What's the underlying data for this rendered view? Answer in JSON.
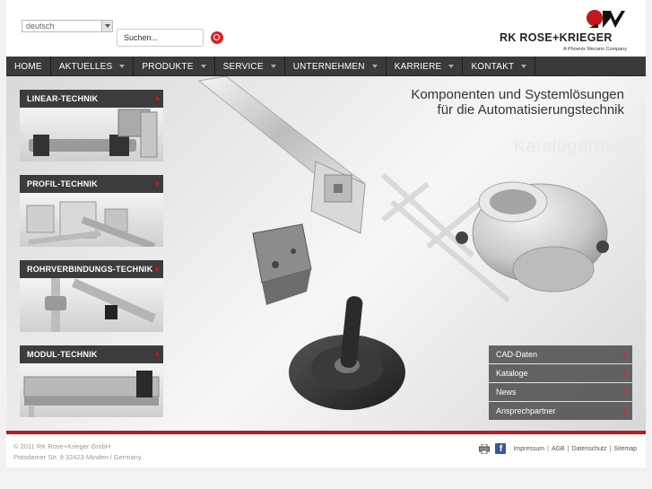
{
  "header": {
    "language": "deutsch",
    "search_placeholder": "Suchen...",
    "logo_text": "RK ROSE+KRIEGER",
    "logo_subtext": "A Phoenix Mecano Company"
  },
  "nav": {
    "items": [
      {
        "label": "HOME",
        "dropdown": false
      },
      {
        "label": "AKTUELLES",
        "dropdown": true
      },
      {
        "label": "PRODUKTE",
        "dropdown": true
      },
      {
        "label": "SERVICE",
        "dropdown": true
      },
      {
        "label": "UNTERNEHMEN",
        "dropdown": true
      },
      {
        "label": "KARRIERE",
        "dropdown": true
      },
      {
        "label": "KONTAKT",
        "dropdown": true
      }
    ]
  },
  "hero": {
    "tagline_line1": "Komponenten und Systemlösungen",
    "tagline_line2": "für die Automatisierungstechnik",
    "watermark": "Katalogartikel"
  },
  "categories": [
    {
      "label": "LINEAR-TECHNIK"
    },
    {
      "label": "PROFIL-TECHNIK"
    },
    {
      "label": "ROHRVERBINDUNGS-TECHNIK"
    },
    {
      "label": "MODUL-TECHNIK"
    }
  ],
  "side_links": [
    {
      "label": "CAD-Daten"
    },
    {
      "label": "Kataloge"
    },
    {
      "label": "News"
    },
    {
      "label": "Ansprechpartner"
    }
  ],
  "footer": {
    "copyright": "© 2011 RK Rose+Krieger GmbH",
    "address": "Potsdamer Str. 9   32423 Minden / Germany",
    "links": [
      "Impressum",
      "AGB",
      "Datenschutz",
      "Sitemap"
    ]
  },
  "colors": {
    "accent_red": "#c4161c",
    "nav_bg": "#3a3a3a",
    "facebook": "#3b5998"
  }
}
